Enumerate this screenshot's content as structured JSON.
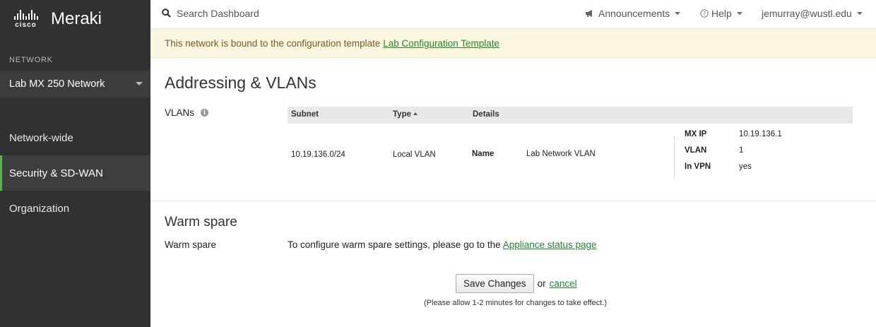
{
  "brand": {
    "cisco": "cisco",
    "product": "Meraki"
  },
  "sidebar": {
    "network_label": "NETWORK",
    "network_selected": "Lab MX 250 Network",
    "items": [
      {
        "label": "Network-wide",
        "active": false
      },
      {
        "label": "Security & SD-WAN",
        "active": true
      },
      {
        "label": "Organization",
        "active": false
      }
    ]
  },
  "topbar": {
    "search_label": "Search Dashboard",
    "announcements": "Announcements",
    "help": "Help",
    "user": "jemurray@wustl.edu"
  },
  "banner": {
    "text": "This network is bound to the configuration template ",
    "link": "Lab Configuration Template"
  },
  "page": {
    "title": "Addressing & VLANs",
    "vlans_label": "VLANs",
    "table": {
      "headers": {
        "subnet": "Subnet",
        "type": "Type",
        "details": "Details"
      },
      "rows": [
        {
          "subnet": "10.19.136.0/24",
          "type": "Local VLAN",
          "name_label": "Name",
          "name_value": "Lab Network VLAN",
          "details": [
            {
              "label": "MX IP",
              "value": "10.19.136.1"
            },
            {
              "label": "VLAN",
              "value": "1"
            },
            {
              "label": "In VPN",
              "value": "yes"
            }
          ]
        }
      ]
    }
  },
  "warm_spare": {
    "title": "Warm spare",
    "label": "Warm spare",
    "text": "To configure warm spare settings, please go to the ",
    "link": "Appliance status page"
  },
  "actions": {
    "save_label": "Save Changes",
    "or": "or",
    "cancel": "cancel",
    "note": "(Please allow 1-2 minutes for changes to take effect.)"
  },
  "colors": {
    "sidebar_bg": "#2f3133",
    "accent": "#5bb54a",
    "link": "#23852f",
    "banner_bg": "#fbf6e0"
  }
}
